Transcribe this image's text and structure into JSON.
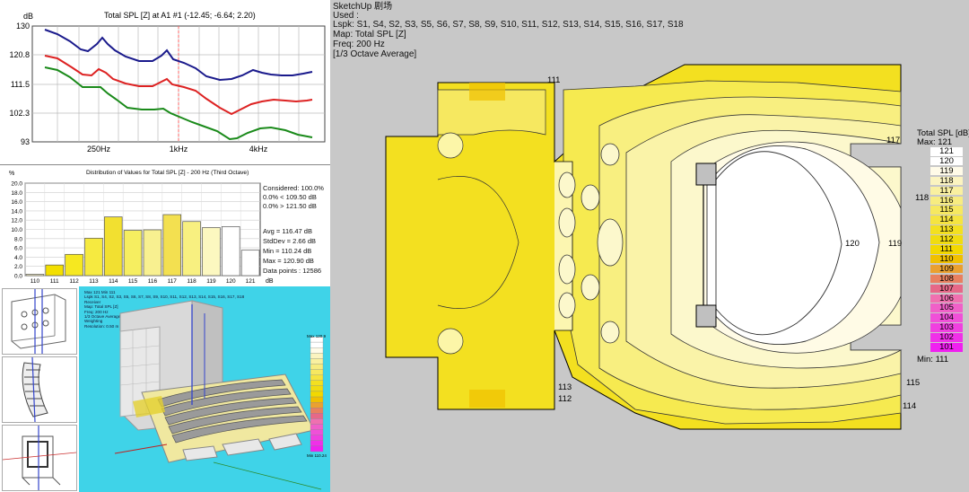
{
  "freq_chart": {
    "title": "Total SPL [Z] at A1 #1  (-12.45; -6.64; 2.20)",
    "y_unit": "dB",
    "y_ticks": [
      "130",
      "120.8",
      "111.5",
      "102.3",
      "93"
    ],
    "x_ticks": [
      "250Hz",
      "1kHz",
      "4kHz"
    ],
    "colors": {
      "blue": "#1a1a8c",
      "red": "#dd2222",
      "green": "#1a8a1a",
      "cursor": "#ff6666"
    }
  },
  "histogram": {
    "title": "Distribution of Values for Total SPL [Z] - 200 Hz (Third Octave)",
    "y_unit": "%",
    "y_ticks": [
      "20.0",
      "18.0",
      "16.0",
      "14.0",
      "12.0",
      "10.0",
      "8.0",
      "6.0",
      "4.0",
      "2.0",
      "0.0"
    ],
    "x_ticks": [
      "110",
      "111",
      "112",
      "113",
      "114",
      "115",
      "116",
      "117",
      "118",
      "119",
      "120",
      "121"
    ],
    "x_unit": "dB",
    "stats": {
      "considered": "Considered: 100.0%",
      "below": "0.0% < 109.50 dB",
      "above": "0.0% > 121.50 dB",
      "avg": "Avg = 116.47 dB",
      "stddev": "StdDev = 2.66 dB",
      "min": "Min = 110.24 dB",
      "max": "Max = 120.90 dB",
      "points": "Data points : 12586"
    }
  },
  "chart_data": {
    "type": "bar",
    "title": "Distribution of Values for Total SPL [Z] - 200 Hz (Third Octave)",
    "xlabel": "dB",
    "ylabel": "%",
    "ylim": [
      0,
      20
    ],
    "categories": [
      "110",
      "111",
      "112",
      "113",
      "114",
      "115",
      "116",
      "117",
      "118",
      "119",
      "120",
      "121"
    ],
    "values": [
      0.3,
      2.3,
      4.6,
      8.1,
      12.7,
      9.8,
      9.9,
      13.2,
      11.7,
      10.4,
      10.6,
      5.5
    ],
    "bar_colors": [
      "#fff7c8",
      "#f3df00",
      "#f6e820",
      "#f6ea40",
      "#f2e030",
      "#f6ee60",
      "#f8f090",
      "#f3e050",
      "#f8f080",
      "#fcf8c0",
      "#ffffff",
      "#ffffff"
    ]
  },
  "view3d": {
    "info_lines": [
      "Max 121  Min 111",
      "Lspk S1, S4, S2, S3, S5, S6, S7, S8, S9, S10, S11, S12, S13, S14, S15, S16, S17, S18",
      "Receiver",
      "Map: Total SPL [Z]",
      "Freq: 200 Hz",
      "1/3 Octave Average",
      "Weighting",
      "Resolution: 0.50 m"
    ],
    "legend_max": "Max 120.9",
    "legend_min": "Min 110.24"
  },
  "map": {
    "info_lines": [
      "SketchUp 剧场",
      "Used :",
      "Lspk: S1, S4, S2, S3, S5, S6, S7, S8, S9, S10, S11, S12, S13, S14, S15, S16, S17, S18",
      "Map: Total SPL [Z]",
      "Freq: 200 Hz",
      "[1/3 Octave Average]"
    ],
    "contour_labels": [
      "111",
      "117",
      "118",
      "120",
      "119",
      "113",
      "112",
      "115",
      "114"
    ],
    "legend_title": "Total SPL [dB]",
    "legend_max": "Max:  121",
    "legend_min": "Min:  111",
    "legend": [
      {
        "v": "121",
        "c": "#ffffff"
      },
      {
        "v": "120",
        "c": "#ffffff"
      },
      {
        "v": "119",
        "c": "#fffbe8"
      },
      {
        "v": "118",
        "c": "#fbf4c0"
      },
      {
        "v": "117",
        "c": "#f9f0a0"
      },
      {
        "v": "116",
        "c": "#f7ec80"
      },
      {
        "v": "115",
        "c": "#f6e860"
      },
      {
        "v": "114",
        "c": "#f5e440"
      },
      {
        "v": "113",
        "c": "#f3e020"
      },
      {
        "v": "112",
        "c": "#f0dc10"
      },
      {
        "v": "111",
        "c": "#f2d800"
      },
      {
        "v": "110",
        "c": "#f0c000"
      },
      {
        "v": "109",
        "c": "#eaa030"
      },
      {
        "v": "108",
        "c": "#e88060"
      },
      {
        "v": "107",
        "c": "#e66888"
      },
      {
        "v": "106",
        "c": "#f070b0"
      },
      {
        "v": "105",
        "c": "#f060c8"
      },
      {
        "v": "104",
        "c": "#f050d8"
      },
      {
        "v": "103",
        "c": "#f040e0"
      },
      {
        "v": "102",
        "c": "#f030e8"
      },
      {
        "v": "101",
        "c": "#f020f0"
      }
    ]
  }
}
